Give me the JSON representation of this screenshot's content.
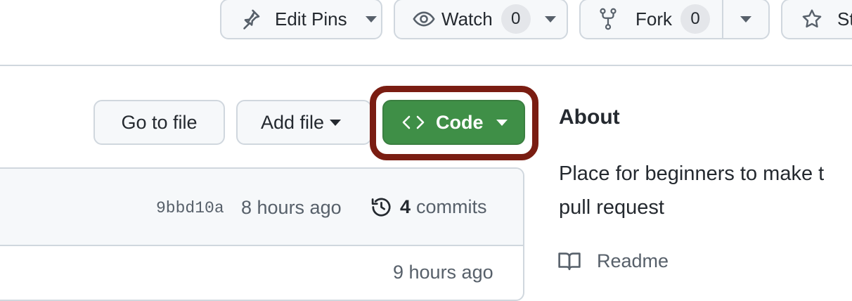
{
  "header": {
    "edit_pins": {
      "label": "Edit Pins"
    },
    "watch": {
      "label": "Watch",
      "count": "0"
    },
    "fork": {
      "label": "Fork",
      "count": "0"
    },
    "star": {
      "label": "St"
    }
  },
  "file_actions": {
    "go_to_file": "Go to file",
    "add_file": "Add file",
    "code": "Code"
  },
  "commit_bar": {
    "hash": "9bbd10a",
    "time": "8 hours ago",
    "commits_count": "4",
    "commits_label": "commits"
  },
  "file_row": {
    "time": "9 hours ago"
  },
  "about": {
    "heading": "About",
    "description_line1": "Place for beginners to make t",
    "description_line2": "pull request",
    "readme": "Readme"
  },
  "colors": {
    "code_button": "#3f8f47",
    "highlight_ring": "#7a1d12",
    "border": "#d0d7de"
  }
}
